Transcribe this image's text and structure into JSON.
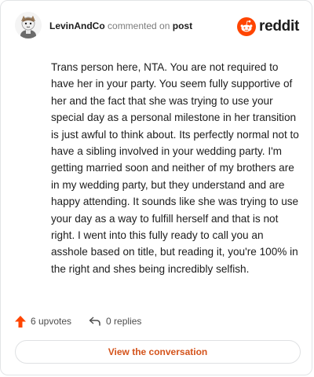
{
  "header": {
    "username": "LevinAndCo",
    "action_text": "commented on",
    "post_link": "post",
    "brand_wordmark": "reddit"
  },
  "comment": {
    "text": "Trans person here, NTA. You are not required to have her in your party. You seem fully supportive of her and the fact that she was trying to use your special day as a personal milestone in her transition is just awful to think about. Its perfectly normal not to have a sibling involved in your wedding party. I'm getting married soon and neither of my brothers are in my wedding party, but they understand and are happy attending. It sounds like she was trying to use your day as a way to fulfill herself and that is not right. I went into this fully ready to call you an asshole based on title, but reading it, you're 100% in the right and shes being incredibly selfish."
  },
  "actions": {
    "upvotes": "6 upvotes",
    "replies": "0 replies"
  },
  "footer": {
    "view_button": "View the conversation"
  },
  "colors": {
    "accent": "#d4531b",
    "reddit_orange": "#ff4500",
    "upvote": "#ff4500"
  },
  "icons": [
    "user-avatar",
    "reddit-logo-icon",
    "upvote-arrow-icon",
    "reply-icon"
  ]
}
